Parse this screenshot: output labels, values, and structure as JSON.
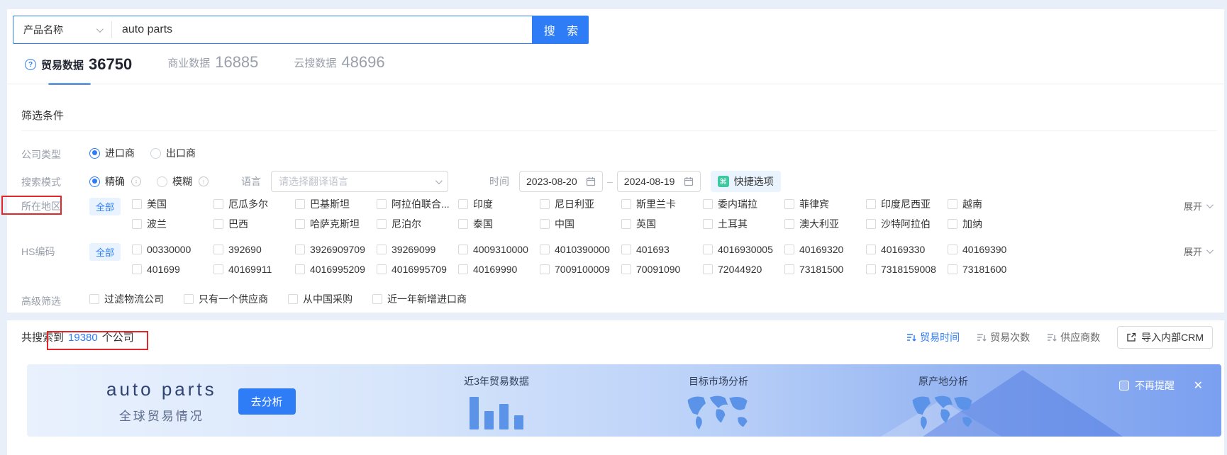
{
  "colors": {
    "accent": "#2e7cf6",
    "annotation_red": "#e12727",
    "quick_icon_green": "#3fc7a0"
  },
  "search": {
    "category": "产品名称",
    "query": "auto parts",
    "button_label": "搜 索"
  },
  "tabs": [
    {
      "label": "贸易数据",
      "count": "36750"
    },
    {
      "label": "商业数据",
      "count": "16885"
    },
    {
      "label": "云搜数据",
      "count": "48696"
    }
  ],
  "filters": {
    "title": "筛选条件",
    "company_type": {
      "label": "公司类型",
      "options": [
        "进口商",
        "出口商"
      ],
      "selected": "进口商"
    },
    "search_mode": {
      "label": "搜索模式",
      "options": [
        "精确",
        "模糊"
      ],
      "selected": "精确"
    },
    "language": {
      "label": "语言",
      "placeholder": "请选择翻译语言"
    },
    "time": {
      "label": "时间",
      "start": "2023-08-20",
      "sep": "–",
      "end": "2024-08-19"
    },
    "quick_option": "快捷选项",
    "region": {
      "label": "所在地区",
      "all": "全部",
      "expand": "展开",
      "row1": [
        "美国",
        "厄瓜多尔",
        "巴基斯坦",
        "阿拉伯联合...",
        "印度",
        "尼日利亚",
        "斯里兰卡",
        "委内瑞拉",
        "菲律宾",
        "印度尼西亚",
        "越南"
      ],
      "row2": [
        "波兰",
        "巴西",
        "哈萨克斯坦",
        "尼泊尔",
        "泰国",
        "中国",
        "英国",
        "土耳其",
        "澳大利亚",
        "沙特阿拉伯",
        "加纳"
      ]
    },
    "hs_code": {
      "label": "HS编码",
      "all": "全部",
      "expand": "展开",
      "row1": [
        "00330000",
        "392690",
        "3926909709",
        "39269099",
        "4009310000",
        "4010390000",
        "401693",
        "4016930005",
        "40169320",
        "40169330",
        "40169390"
      ],
      "row2": [
        "401699",
        "40169911",
        "4016995209",
        "4016995709",
        "40169990",
        "7009100009",
        "70091090",
        "72044920",
        "73181500",
        "7318159008",
        "73181600"
      ]
    },
    "advanced": {
      "label": "高级筛选",
      "options": [
        "过滤物流公司",
        "只有一个供应商",
        "从中国采购",
        "近一年新增进口商"
      ]
    }
  },
  "results": {
    "summary_prefix": "共搜索到",
    "count": "19380",
    "summary_suffix": "个公司",
    "sorts": [
      "贸易时间",
      "贸易次数",
      "供应商数"
    ],
    "active_sort": "贸易时间",
    "crm_button": "导入内部CRM"
  },
  "banner": {
    "title": "auto parts",
    "subtitle": "全球贸易情况",
    "analyze_button": "去分析",
    "card1": "近3年贸易数据",
    "card2": "目标市场分析",
    "card3": "原产地分析",
    "dismiss": "不再提醒",
    "close": "✕"
  }
}
